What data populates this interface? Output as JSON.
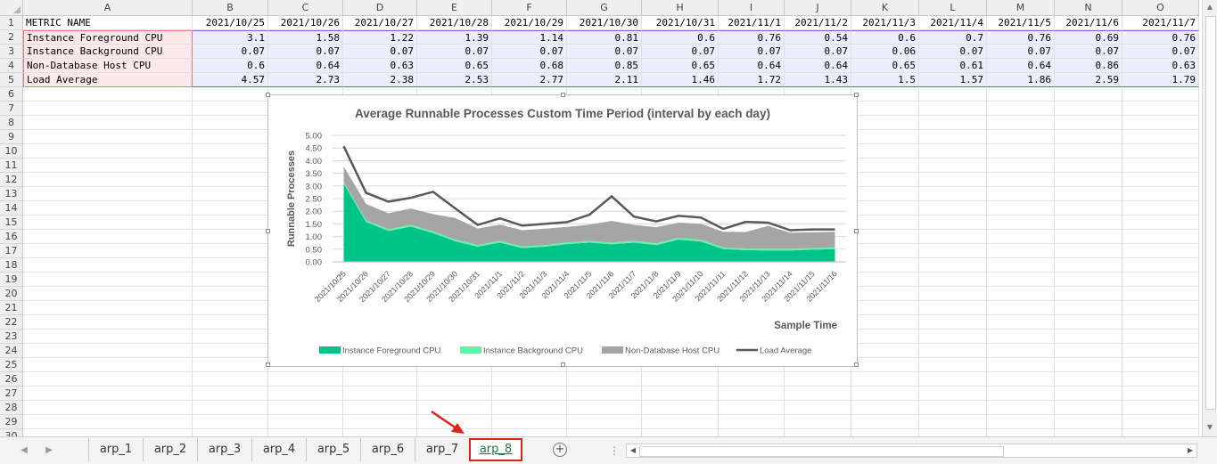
{
  "sheet": {
    "columns": [
      "A",
      "B",
      "C",
      "D",
      "E",
      "F",
      "G",
      "H",
      "I",
      "J",
      "K",
      "L",
      "M",
      "N",
      "O"
    ],
    "rows": [
      "1",
      "2",
      "3",
      "4",
      "5",
      "6",
      "7",
      "8",
      "9",
      "10",
      "11",
      "12",
      "13",
      "14",
      "15",
      "16",
      "17",
      "18",
      "19",
      "20",
      "21",
      "22",
      "23",
      "24",
      "25",
      "26",
      "27",
      "28",
      "29",
      "30"
    ],
    "header_row": [
      "METRIC NAME",
      "2021/10/25",
      "2021/10/26",
      "2021/10/27",
      "2021/10/28",
      "2021/10/29",
      "2021/10/30",
      "2021/10/31",
      "2021/11/1",
      "2021/11/2",
      "2021/11/3",
      "2021/11/4",
      "2021/11/5",
      "2021/11/6",
      "2021/11/7"
    ],
    "data_rows": [
      [
        "Instance Foreground CPU",
        "3.1",
        "1.58",
        "1.22",
        "1.39",
        "1.14",
        "0.81",
        "0.6",
        "0.76",
        "0.54",
        "0.6",
        "0.7",
        "0.76",
        "0.69",
        "0.76"
      ],
      [
        "Instance Background CPU",
        "0.07",
        "0.07",
        "0.07",
        "0.07",
        "0.07",
        "0.07",
        "0.07",
        "0.07",
        "0.07",
        "0.06",
        "0.07",
        "0.07",
        "0.07",
        "0.07"
      ],
      [
        "Non-Database Host CPU",
        "0.6",
        "0.64",
        "0.63",
        "0.65",
        "0.68",
        "0.85",
        "0.65",
        "0.64",
        "0.64",
        "0.65",
        "0.61",
        "0.64",
        "0.86",
        "0.63"
      ],
      [
        "Load Average",
        "4.57",
        "2.73",
        "2.38",
        "2.53",
        "2.77",
        "2.11",
        "1.46",
        "1.72",
        "1.43",
        "1.5",
        "1.57",
        "1.86",
        "2.59",
        "1.79"
      ]
    ]
  },
  "chart_data": {
    "type": "area",
    "title": "Average Runnable Processes Custom Time Period (interval by each day)",
    "xlabel": "Sample Time",
    "ylabel": "Runnable Processes",
    "ylim": [
      0,
      5
    ],
    "yticks": [
      "5.00",
      "4.50",
      "4.00",
      "3.50",
      "3.00",
      "2.50",
      "2.00",
      "1.50",
      "1.00",
      "0.50",
      "0.00"
    ],
    "grid": true,
    "legend_position": "bottom",
    "categories": [
      "2021/10/25",
      "2021/10/26",
      "2021/10/27",
      "2021/10/28",
      "2021/10/29",
      "2021/10/30",
      "2021/10/31",
      "2021/11/1",
      "2021/11/2",
      "2021/11/3",
      "2021/11/4",
      "2021/11/5",
      "2021/11/6",
      "2021/11/7",
      "2021/11/8",
      "2021/11/9",
      "2021/11/10",
      "2021/11/11",
      "2021/11/12",
      "2021/11/13",
      "2021/11/14",
      "2021/11/15",
      "2021/11/16"
    ],
    "series": [
      {
        "name": "Instance Foreground CPU",
        "kind": "stacked-area",
        "color": "#00c389",
        "values": [
          3.1,
          1.58,
          1.22,
          1.39,
          1.14,
          0.81,
          0.6,
          0.76,
          0.54,
          0.6,
          0.7,
          0.76,
          0.69,
          0.76,
          0.66,
          0.88,
          0.8,
          0.5,
          0.46,
          0.45,
          0.45,
          0.48,
          0.5
        ]
      },
      {
        "name": "Instance Background CPU",
        "kind": "stacked-area",
        "color": "#66f0a8",
        "values": [
          0.07,
          0.07,
          0.07,
          0.07,
          0.07,
          0.07,
          0.07,
          0.07,
          0.07,
          0.06,
          0.07,
          0.07,
          0.07,
          0.07,
          0.07,
          0.07,
          0.07,
          0.07,
          0.07,
          0.07,
          0.07,
          0.07,
          0.07
        ]
      },
      {
        "name": "Non-Database Host CPU",
        "kind": "stacked-area",
        "color": "#a5a5a5",
        "values": [
          0.6,
          0.64,
          0.63,
          0.65,
          0.68,
          0.85,
          0.65,
          0.64,
          0.64,
          0.65,
          0.61,
          0.64,
          0.86,
          0.63,
          0.64,
          0.6,
          0.63,
          0.62,
          0.65,
          0.9,
          0.63,
          0.62,
          0.62
        ]
      },
      {
        "name": "Load Average",
        "kind": "line",
        "color": "#595959",
        "values": [
          4.57,
          2.73,
          2.38,
          2.53,
          2.77,
          2.11,
          1.46,
          1.72,
          1.43,
          1.5,
          1.57,
          1.86,
          2.59,
          1.79,
          1.6,
          1.82,
          1.75,
          1.3,
          1.58,
          1.55,
          1.25,
          1.28,
          1.28
        ]
      }
    ]
  },
  "tabs": {
    "items": [
      "arp_1",
      "arp_2",
      "arp_3",
      "arp_4",
      "arp_5",
      "arp_6",
      "arp_7",
      "arp_8"
    ],
    "active": "arp_8",
    "add_symbol": "+",
    "separator": "⋮"
  },
  "colors": {
    "annotation": "#e2231a",
    "active_tab_text": "#1f7a3f",
    "header_bg": "#efefef"
  }
}
